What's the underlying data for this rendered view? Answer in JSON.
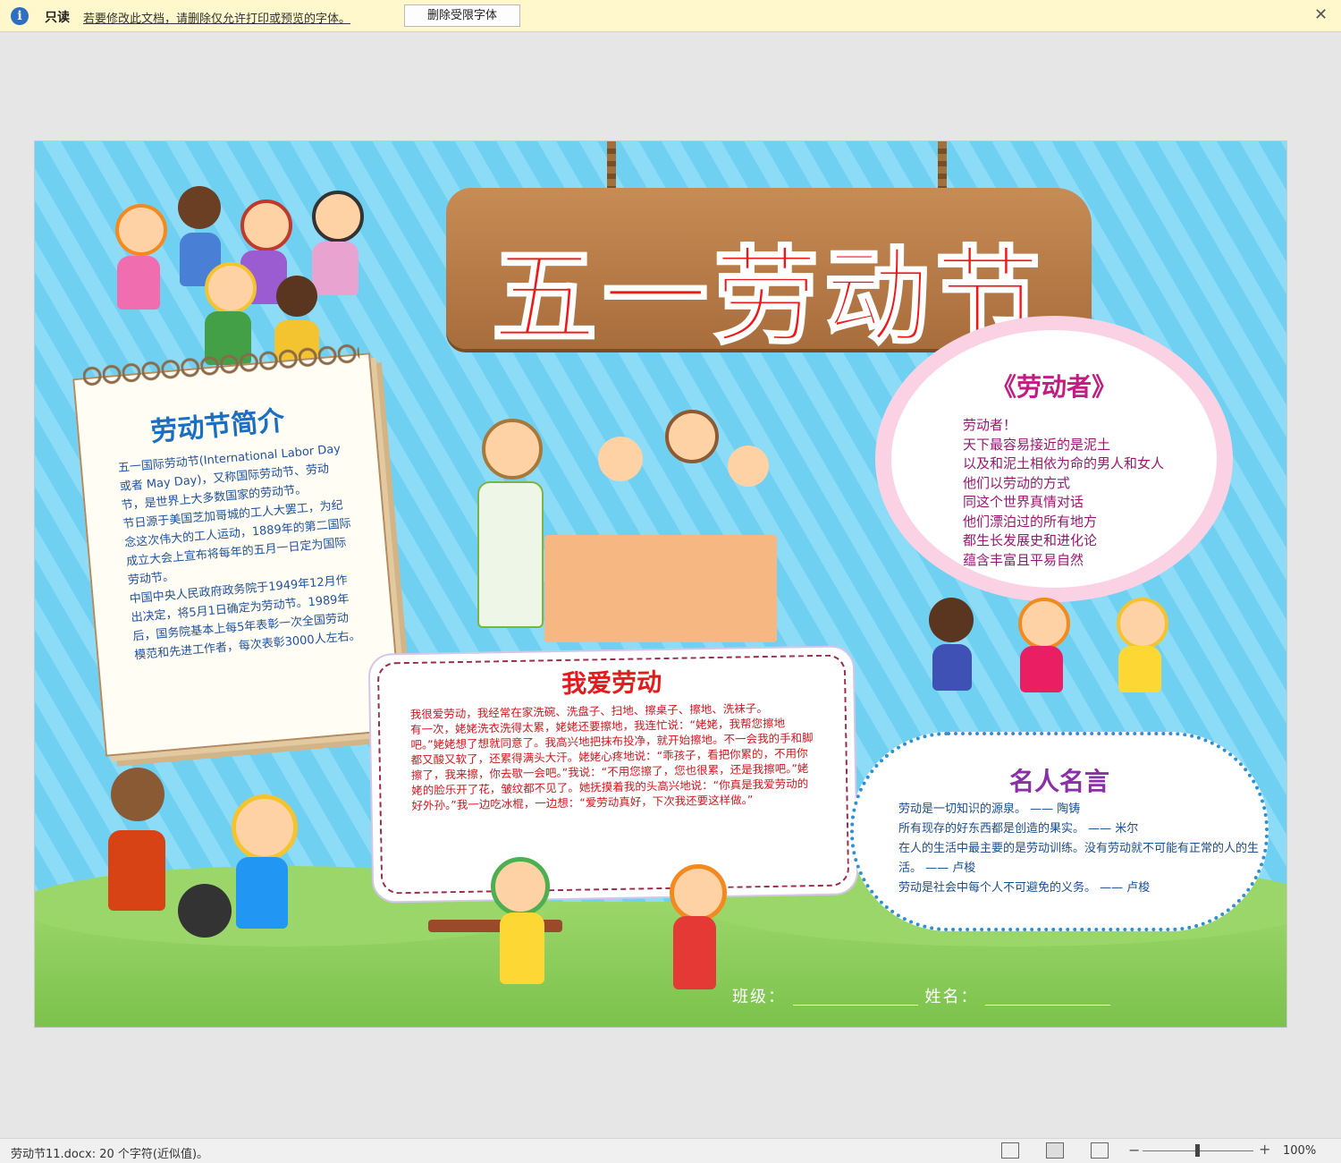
{
  "infobar": {
    "readonly_label": "只读",
    "message": "若要修改此文档，请删除仅允许打印或预览的字体。",
    "button_label": "删除受限字体",
    "close_icon": "close-icon"
  },
  "document": {
    "title": "五一劳动节",
    "intro": {
      "heading": "劳动节简介",
      "body": "五一国际劳动节(International Labor Day 或者 May Day)，又称国际劳动节、劳动节，是世界上大多数国家的劳动节。\n节日源于美国芝加哥城的工人大罢工，为纪念这次伟大的工人运动，1889年的第二国际成立大会上宣布将每年的五月一日定为国际劳动节。\n中国中央人民政府政务院于1949年12月作出决定，将5月1日确定为劳动节。1989年后，国务院基本上每5年表彰一次全国劳动模范和先进工作者，每次表彰3000人左右。"
    },
    "poem": {
      "title": "《劳动者》",
      "lines": "劳动者！\n天下最容易接近的是泥土\n以及和泥土相依为命的男人和女人\n他们以劳动的方式\n同这个世界真情对话\n他们漂泊过的所有地方\n都生长发展史和进化论\n蕴含丰富且平易自然"
    },
    "love": {
      "title": "我爱劳动",
      "body": "我很爱劳动，我经常在家洗碗、洗盘子、扫地、擦桌子、擦地、洗袜子。\n有一次，姥姥洗衣洗得太累，姥姥还要擦地，我连忙说：“姥姥，我帮您擦地吧。”姥姥想了想就同意了。我高兴地把抹布投净，就开始擦地。不一会我的手和脚都又酸又软了，还累得满头大汗。姥姥心疼地说：“乖孩子，看把你累的，不用你擦了，我来擦，你去歇一会吧。”我说：“不用您擦了，您也很累，还是我擦吧。”姥姥的脸乐开了花，皱纹都不见了。她抚摸着我的头高兴地说：“你真是我爱劳动的好外孙。”我一边吃冰棍，一边想：“爱劳动真好，下次我还要这样做。”"
    },
    "quotes": {
      "title": "名人名言",
      "lines": "劳动是一切知识的源泉。 —— 陶铸\n所有现存的好东西都是创造的果实。 —— 米尔\n在人的生活中最主要的是劳动训练。没有劳动就不可能有正常的人的生活。 —— 卢梭\n劳动是社会中每个人不可避免的义务。 —— 卢梭"
    },
    "class_label": "班级：",
    "name_label": "姓名："
  },
  "statusbar": {
    "file_info": "劳动节11.docx: 20 个字符(近似值)。",
    "zoom": "100%",
    "zoom_minus": "−",
    "zoom_plus": "+"
  }
}
